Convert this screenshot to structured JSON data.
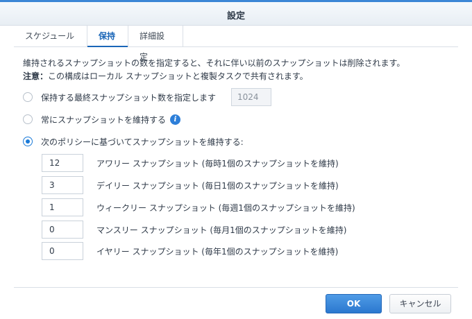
{
  "window": {
    "title": "設定"
  },
  "tabs": [
    {
      "label": "スケジュール",
      "active": false
    },
    {
      "label": "保持",
      "active": true
    },
    {
      "label": "詳細設定",
      "active": false
    }
  ],
  "description": "維持されるスナップショットの数を指定すると、それに伴い以前のスナップショットは削除されます。",
  "note": {
    "prefix": "注意：",
    "text": "この構成はローカル スナップショットと複製タスクで共有されます。"
  },
  "options": {
    "max_count": {
      "label": "保持する最終スナップショット数を指定します",
      "checked": false,
      "value": "1024"
    },
    "keep_all": {
      "label": "常にスナップショットを維持する",
      "checked": false,
      "info_icon": "info-icon"
    },
    "policy": {
      "label": "次のポリシーに基づいてスナップショットを維持する:",
      "checked": true
    }
  },
  "policy_rows": [
    {
      "value": "12",
      "label": "アワリー スナップショット (毎時1個のスナップショットを維持)"
    },
    {
      "value": "3",
      "label": "デイリー スナップショット (毎日1個のスナップショットを維持)"
    },
    {
      "value": "1",
      "label": "ウィークリー スナップショット (毎週1個のスナップショットを維持)"
    },
    {
      "value": "0",
      "label": "マンスリー スナップショット (毎月1個のスナップショットを維持)"
    },
    {
      "value": "0",
      "label": "イヤリー スナップショット (毎年1個のスナップショットを維持)"
    }
  ],
  "buttons": {
    "ok": "OK",
    "cancel": "キャンセル"
  },
  "colors": {
    "accent": "#1a66b8",
    "primary_button": "#2b78cf",
    "title_bar_top": "#3d87d6"
  }
}
